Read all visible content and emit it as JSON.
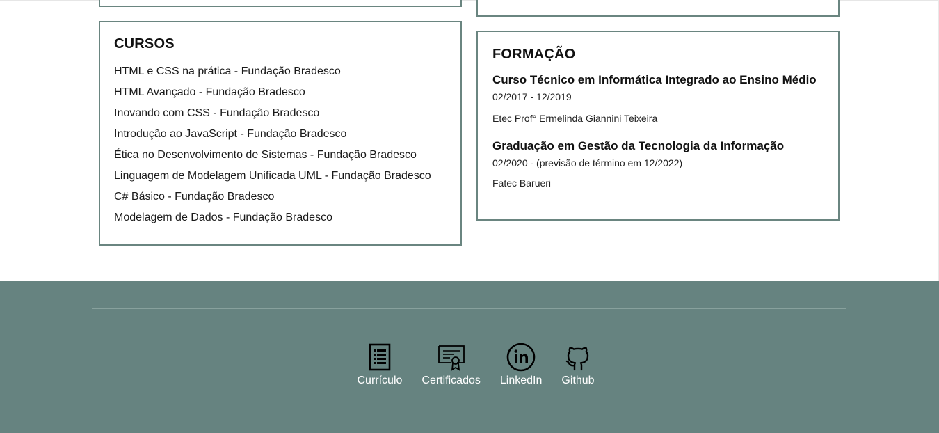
{
  "cursos": {
    "heading": "CURSOS",
    "items": [
      "HTML e CSS na prática - Fundação Bradesco",
      "HTML Avançado - Fundação Bradesco",
      "Inovando com CSS - Fundação Bradesco",
      "Introdução ao JavaScript - Fundação Bradesco",
      "Ética no Desenvolvimento de Sistemas - Fundação Bradesco",
      "Linguagem de Modelagem Unificada UML - Fundação Bradesco",
      "C# Básico - Fundação Bradesco",
      "Modelagem de Dados - Fundação Bradesco"
    ]
  },
  "formacao": {
    "heading": "FORMAÇÃO",
    "items": [
      {
        "title": "Curso Técnico em Informática Integrado ao Ensino Médio",
        "period": "02/2017 - 12/2019",
        "school": "Etec Prof° Ermelinda Giannini Teixeira"
      },
      {
        "title": "Graduação em Gestão da Tecnologia da Informação",
        "period": "02/2020 - (previsão de término em 12/2022)",
        "school": "Fatec Barueri"
      }
    ]
  },
  "footer": {
    "background": "#668380",
    "links": [
      {
        "label": "Currículo",
        "icon": "document-icon"
      },
      {
        "label": "Certificados",
        "icon": "certificate-icon"
      },
      {
        "label": "LinkedIn",
        "icon": "linkedin-icon"
      },
      {
        "label": "Github",
        "icon": "github-icon"
      }
    ]
  },
  "colors": {
    "card_border": "#6a8580",
    "footer_bg": "#668380",
    "text": "#111111"
  }
}
